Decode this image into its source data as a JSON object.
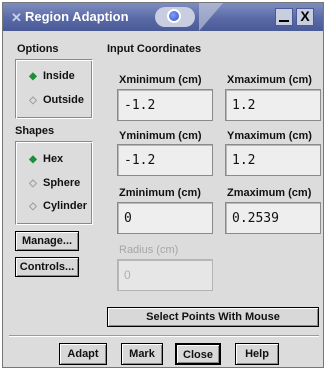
{
  "window": {
    "title": "Region Adaption",
    "title_icon": "app-icon",
    "minimize_label": "_",
    "close_label": "X"
  },
  "options": {
    "label": "Options",
    "items": [
      {
        "label": "Inside",
        "selected": true
      },
      {
        "label": "Outside",
        "selected": false
      }
    ]
  },
  "shapes": {
    "label": "Shapes",
    "items": [
      {
        "label": "Hex",
        "selected": true
      },
      {
        "label": "Sphere",
        "selected": false
      },
      {
        "label": "Cylinder",
        "selected": false
      }
    ]
  },
  "side_buttons": {
    "manage": "Manage...",
    "controls": "Controls..."
  },
  "input": {
    "label": "Input Coordinates",
    "xmin_label": "Xminimum (cm)",
    "xmin_value": "-1.2",
    "xmax_label": "Xmaximum (cm)",
    "xmax_value": "1.2",
    "ymin_label": "Yminimum (cm)",
    "ymin_value": "-1.2",
    "ymax_label": "Ymaximum (cm)",
    "ymax_value": "1.2",
    "zmin_label": "Zminimum (cm)",
    "zmin_value": "0",
    "zmax_label": "Zmaximum (cm)",
    "zmax_value": "0.2539",
    "radius_label": "Radius (cm)",
    "radius_value": "0"
  },
  "select_button": "Select Points With Mouse",
  "bottom_buttons": {
    "adapt": "Adapt",
    "mark": "Mark",
    "close": "Close",
    "help": "Help"
  },
  "glyphs": {
    "radio_on": "◆",
    "radio_off": "◇",
    "app_icon": "✕"
  },
  "colors": {
    "titlebar": "#5a6aa6",
    "dialog_bg": "#dcdcdc",
    "radio_on": "#1c8f3a"
  }
}
